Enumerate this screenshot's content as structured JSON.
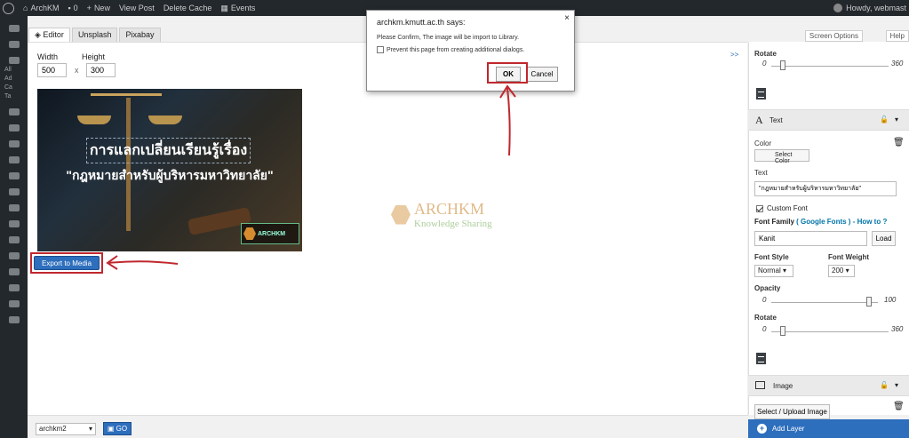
{
  "colors": {
    "accent": "#2d6ebd",
    "highlight": "#c0272d",
    "adminbar": "#23282d"
  },
  "adminbar": {
    "site": "ArchKM",
    "comments": "0",
    "new": "New",
    "view_post": "View Post",
    "delete_cache": "Delete Cache",
    "events": "Events",
    "howdy": "Howdy, webmast"
  },
  "sidebar": {
    "labels": [
      "All",
      "Ad",
      "Ca",
      "Ta"
    ]
  },
  "tabs": [
    "Editor",
    "Unsplash",
    "Pixabay"
  ],
  "screen_options": "Screen Options",
  "help": "Help",
  "dimensions": {
    "width_label": "Width",
    "height_label": "Height",
    "width": "500",
    "height": "300",
    "times": "x"
  },
  "canvas": {
    "line1": "การแลกเปลี่ยนเรียนรู้เรื่อง",
    "line2": "\"กฎหมายสำหรับผู้บริหารมหาวิทยาลัย\"",
    "badge": "ARCHKM"
  },
  "export_label": "Export to Media",
  "watermark": {
    "title": "ARCHKM",
    "subtitle": "Knowledge Sharing"
  },
  "dialog": {
    "title": "archkm.kmutt.ac.th says:",
    "message": "Please Confirm, The image will be import to Library.",
    "checkbox": "Prevent this page from creating additional dialogs.",
    "ok": "OK",
    "cancel": "Cancel",
    "close": "×"
  },
  "panel": {
    "expand": ">>",
    "rotate_label": "Rotate",
    "rotate_min": "0",
    "rotate_max": "360",
    "text_section": "Text",
    "color_label": "Color",
    "select_color": "Select Color",
    "text_label": "Text",
    "text_value": "\"กฎหมายสำหรับผู้บริหารมหาวิทยาลัย\"",
    "custom_font": "Custom Font",
    "font_family_label": "Font Family",
    "google_fonts": "( Google Fonts )",
    "how_to": "- How to ?",
    "font_value": "Kanit",
    "load": "Load",
    "font_style_label": "Font Style",
    "font_style_value": "Normal",
    "font_weight_label": "Font Weight",
    "font_weight_value": "200",
    "opacity_label": "Opacity",
    "opacity_min": "0",
    "opacity_max": "100",
    "rotate2_label": "Rotate",
    "rotate2_min": "0",
    "rotate2_max": "360",
    "image_section": "Image",
    "upload": "Select / Upload Image",
    "add_layer": "Add Layer"
  },
  "bottom": {
    "select_value": "archkm2",
    "go": "GO"
  }
}
